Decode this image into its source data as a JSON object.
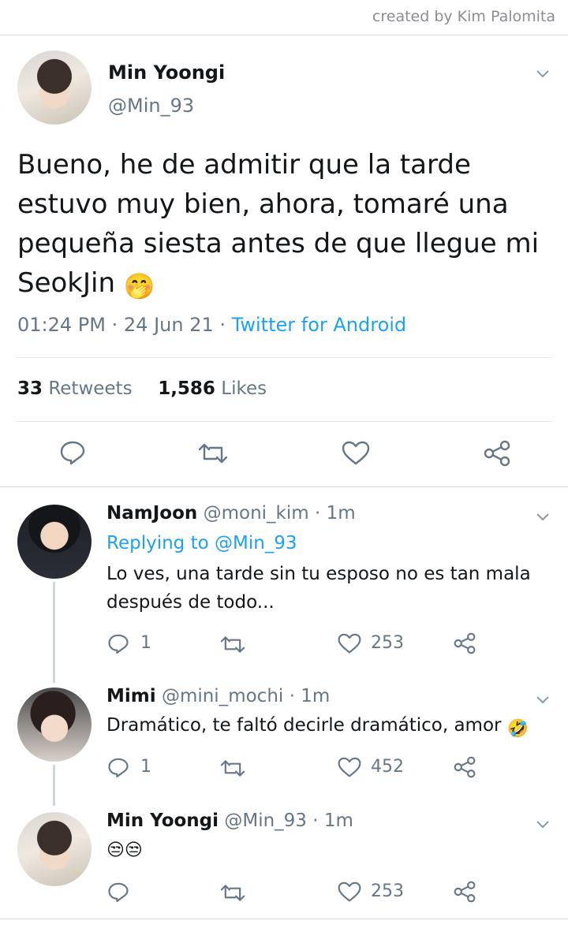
{
  "credit": "created by Kim Palomita",
  "tweet": {
    "display_name": "Min Yoongi",
    "handle": "@Min_93",
    "text": "Bueno, he de admitir que la tarde estuvo muy bien, ahora, tomaré una pequeña siesta antes de que llegue mi SeokJin",
    "text_emoji": "🤭",
    "time": "01:24 PM",
    "date": "24 Jun 21",
    "source": "Twitter for Android",
    "retweets_count": "33",
    "retweets_label": "Retweets",
    "likes_count": "1,586",
    "likes_label": "Likes",
    "separator": "·"
  },
  "replies": [
    {
      "display_name": "NamJoon",
      "handle": "@moni_kim",
      "time": "1m",
      "replying_prefix": "Replying to",
      "replying_to": "@Min_93",
      "text": "Lo ves, una tarde sin tu esposo no es tan mala después de todo...",
      "reply_count": "1",
      "like_count": "253"
    },
    {
      "display_name": "Mimi",
      "handle": "@mini_mochi",
      "time": "1m",
      "text": "Dramático, te faltó decirle dramático, amor",
      "text_emoji": "🤣",
      "reply_count": "1",
      "like_count": "452"
    },
    {
      "display_name": "Min Yoongi",
      "handle": "@Min_93",
      "time": "1m",
      "text_emoji": "😒😒",
      "like_count": "253"
    }
  ],
  "colors": {
    "link": "#1da1f2",
    "muted": "#657786",
    "icon": "#657786"
  }
}
